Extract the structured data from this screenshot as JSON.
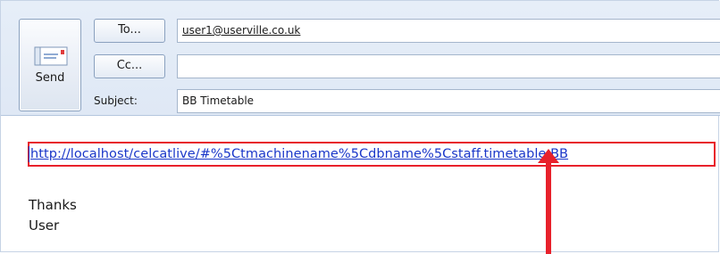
{
  "compose": {
    "send_label": "Send",
    "to_button_label": "To...",
    "cc_button_label": "Cc...",
    "subject_label": "Subject:",
    "to_value": "user1@userville.co.uk",
    "cc_value": "",
    "subject_value": "BB Timetable"
  },
  "message": {
    "url": "http://localhost/celcatlive/#%5Ctmachinename%5Cdbname%5Cstaff.timetable.BB",
    "line1": "Thanks",
    "line2": "User"
  },
  "colors": {
    "highlight": "#e8212b",
    "link": "#1a37c9"
  }
}
